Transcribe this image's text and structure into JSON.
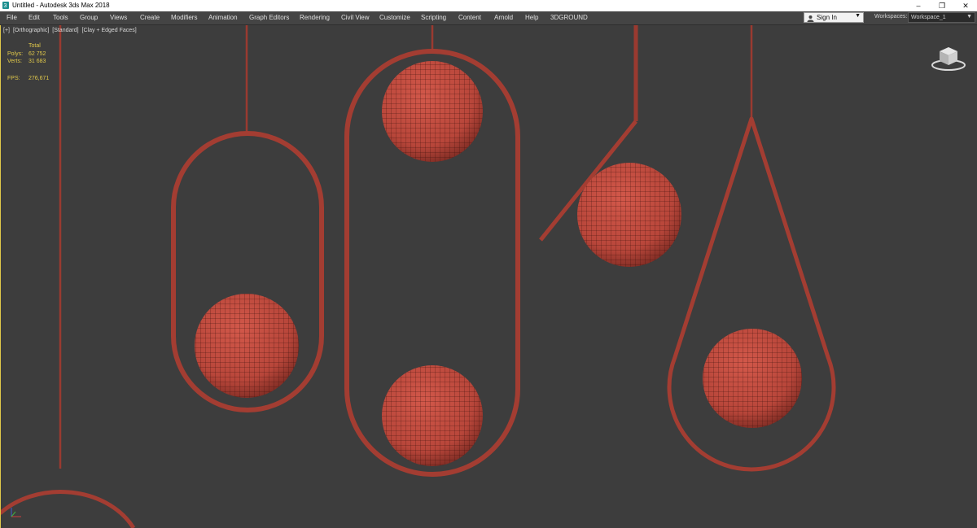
{
  "window": {
    "title": "Untitled - Autodesk 3ds Max 2018",
    "controls": [
      "–",
      "❐",
      "✕"
    ]
  },
  "menu": {
    "items": [
      "File",
      "Edit",
      "Tools",
      "Group",
      "Views",
      "Create",
      "Modifiers",
      "Animation",
      "Graph Editors",
      "Rendering",
      "Civil View",
      "Customize",
      "Scripting",
      "Content",
      "Arnold",
      "Help",
      "3DGROUND"
    ],
    "sign_in": "Sign In",
    "workspaces_label": "Workspaces:",
    "workspace_value": "Workspace_1"
  },
  "viewport": {
    "label_parts": [
      "[+]",
      "[Orthographic]",
      "[Standard]",
      "[Clay + Edged Faces]"
    ],
    "stats": {
      "total_label": "Total",
      "polys_label": "Polys:",
      "polys_value": "62 752",
      "verts_label": "Verts:",
      "verts_value": "31 683",
      "fps_label": "FPS:",
      "fps_value": "276,671"
    }
  },
  "colors": {
    "viewport_bg": "#3d3d3d",
    "model_red": "#c4483c",
    "wire": "#3a0f0c",
    "stats_yellow": "#e0c84a"
  },
  "icons": {
    "app": "3ds-max-icon",
    "user": "user-icon",
    "viewcube": "viewcube-icon",
    "axis": "axis-gizmo-icon"
  }
}
